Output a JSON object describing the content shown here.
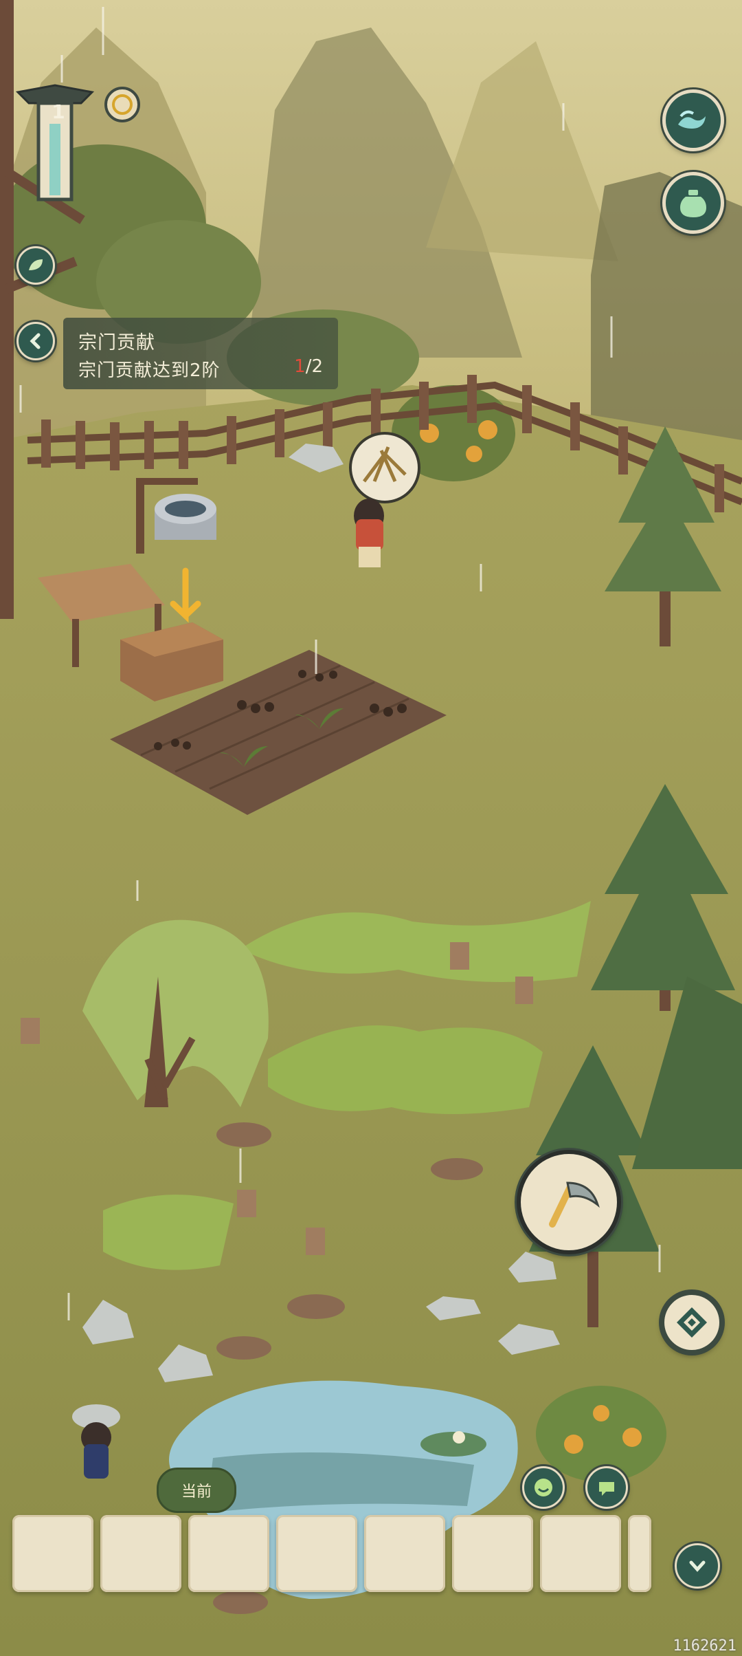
{
  "quest": {
    "title": "宗门贡献",
    "description": "宗门贡献达到2阶",
    "progress_current": "1",
    "progress_total": "/2"
  },
  "player": {
    "level": "1"
  },
  "hud": {
    "current_label": "当前",
    "watermark": "1162621"
  },
  "inventory": {
    "slot_count": 8,
    "visible_full_slots": 7
  },
  "icons": {
    "top_right_1": "wave-icon",
    "top_right_2": "jar-icon",
    "left_1": "leaf-icon",
    "back": "back-arrow-icon",
    "tool": "sickle-icon",
    "menu": "diamond-grid-icon",
    "emoji": "smile-icon",
    "chat": "chat-icon",
    "collapse": "chevron-down-icon"
  },
  "colors": {
    "panel": "#424e3e",
    "button_fill": "#2f5a4f",
    "button_ring": "#e7dcc2",
    "progress_current": "#e24a3a",
    "slot_fill": "#ebe2c9"
  }
}
